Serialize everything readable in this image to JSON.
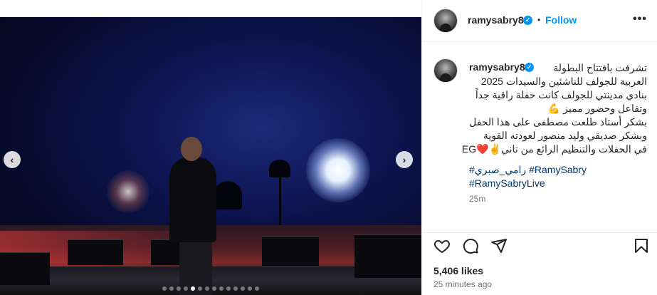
{
  "post": {
    "username": "ramysabry8",
    "follow_label": "Follow",
    "separator": "•",
    "more_label": "•••",
    "caption_lines": [
      "تشرفت بافتتاح البطولة",
      "العربية للجولف للناشئين والسيدات 2025",
      "بنادي مدينتي للجولف كانت حفلة راقية جداً",
      "وتفاعل وحضور مميز 💪",
      "بشكر أستاذ طلعت مصطفى على هذا الحفل",
      "وبشكر صديقي وليد منصور لعودته القوية",
      "في الحفلات والتنظيم الرائع من تاني✌️❤️EG"
    ],
    "hashtags": [
      "#رامي_صبري #RamySabry",
      "#RamySabryLive"
    ],
    "caption_time": "25m",
    "likes": "5,406 likes",
    "posted_ago": "25 minutes ago"
  },
  "carousel": {
    "prev_label": "‹",
    "next_label": "›",
    "slide_count": 14,
    "active_index": 4
  },
  "colors": {
    "accent": "#0095f6",
    "link": "#00376b",
    "text": "#262626",
    "muted": "#737373"
  },
  "icons": [
    "heart-icon",
    "comment-icon",
    "share-icon",
    "bookmark-icon",
    "verified-badge-icon",
    "more-options-icon"
  ]
}
